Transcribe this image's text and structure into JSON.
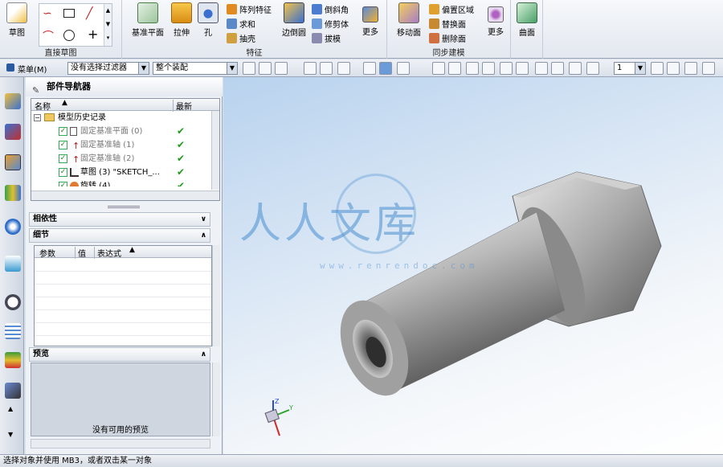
{
  "ribbon": {
    "sketch": {
      "label": "草图",
      "group_label": "直接草图"
    },
    "features": {
      "datum_plane": "基准平面",
      "extrude": "拉伸",
      "hole": "孔",
      "small": [
        "阵列特征",
        "求和",
        "抽壳"
      ],
      "edge_blend": "边倒圆",
      "small2": [
        "倒斜角",
        "修剪体",
        "拔模"
      ],
      "more": "更多",
      "group_label": "特征"
    },
    "sync": {
      "move_face": "移动面",
      "small": [
        "偏置区域",
        "替换面",
        "删除面"
      ],
      "more": "更多",
      "group_label": "同步建模"
    },
    "surface": {
      "label": "曲面"
    }
  },
  "toolbar2": {
    "menu": "菜单(M)",
    "filter": "没有选择过滤器",
    "assembly": "整个装配",
    "layer": "1"
  },
  "navigator": {
    "title": "部件导航器",
    "col_name": "名称",
    "col_latest": "最新",
    "root": "模型历史记录",
    "items": [
      {
        "label": "固定基准平面 (0)",
        "ok": "✔"
      },
      {
        "label": "固定基准轴 (1)",
        "ok": "✔"
      },
      {
        "label": "固定基准轴 (2)",
        "ok": "✔"
      },
      {
        "label": "草图 (3) \"SKETCH_...",
        "ok": "✔"
      },
      {
        "label": "旋转 (4)",
        "ok": "✔"
      }
    ],
    "dependencies": "相依性",
    "details": "细节",
    "detail_cols": [
      "参数",
      "值",
      "表达式"
    ],
    "preview": "预览",
    "no_preview": "没有可用的预览"
  },
  "status": {
    "text": "选择对象并使用 MB3，或者双击某一对象"
  },
  "watermark": {
    "text": "人人文库",
    "url": "www.renrendoc.com"
  },
  "colors": {
    "accent": "#4a8fd0",
    "check": "#1c9b1c"
  }
}
